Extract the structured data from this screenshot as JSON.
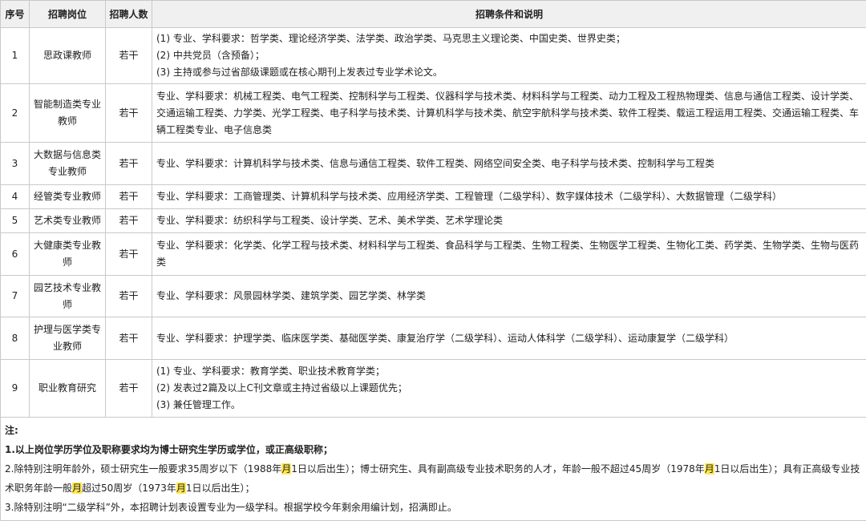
{
  "headers": [
    "序号",
    "招聘岗位",
    "招聘人数",
    "招聘条件和说明"
  ],
  "rows": [
    {
      "no": "1",
      "post": "思政课教师",
      "count": "若干",
      "lines": [
        "(1) 专业、学科要求：哲学类、理论经济学类、法学类、政治学类、马克思主义理论类、中国史类、世界史类；",
        "(2) 中共党员（含预备）；",
        "(3) 主持或参与过省部级课题或在核心期刊上发表过专业学术论文。"
      ]
    },
    {
      "no": "2",
      "post": "智能制造类专业教师",
      "count": "若干",
      "lines": [
        "专业、学科要求：机械工程类、电气工程类、控制科学与工程类、仪器科学与技术类、材料科学与工程类、动力工程及工程热物理类、信息与通信工程类、设计学类、交通运输工程类、力学类、光学工程类、电子科学与技术类、计算机科学与技术类、航空宇航科学与技术类、软件工程类、载运工程运用工程类、交通运输工程类、车辆工程类专业、电子信息类"
      ]
    },
    {
      "no": "3",
      "post": "大数据与信息类专业教师",
      "count": "若干",
      "lines": [
        "专业、学科要求：计算机科学与技术类、信息与通信工程类、软件工程类、网络空间安全类、电子科学与技术类、控制科学与工程类"
      ]
    },
    {
      "no": "4",
      "post": "经管类专业教师",
      "count": "若干",
      "lines": [
        "专业、学科要求：工商管理类、计算机科学与技术类、应用经济学类、工程管理（二级学科）、数字媒体技术（二级学科）、大数据管理（二级学科）"
      ]
    },
    {
      "no": "5",
      "post": "艺术类专业教师",
      "count": "若干",
      "lines": [
        "专业、学科要求：纺织科学与工程类、设计学类、艺术、美术学类、艺术学理论类"
      ]
    },
    {
      "no": "6",
      "post": "大健康类专业教师",
      "count": "若干",
      "lines": [
        "专业、学科要求：化学类、化学工程与技术类、材料科学与工程类、食品科学与工程类、生物工程类、生物医学工程类、生物化工类、药学类、生物学类、生物与医药类"
      ]
    },
    {
      "no": "7",
      "post": "园艺技术专业教师",
      "count": "若干",
      "lines": [
        "专业、学科要求：风景园林学类、建筑学类、园艺学类、林学类"
      ]
    },
    {
      "no": "8",
      "post": "护理与医学类专业教师",
      "count": "若干",
      "lines": [
        "专业、学科要求：护理学类、临床医学类、基础医学类、康复治疗学（二级学科）、运动人体科学（二级学科）、运动康复学（二级学科）"
      ]
    },
    {
      "no": "9",
      "post": "职业教育研究",
      "count": "若干",
      "lines": [
        "(1) 专业、学科要求：教育学类、职业技术教育学类；",
        "(2) 发表过2篇及以上C刊文章或主持过省级以上课题优先；",
        "(3) 兼任管理工作。"
      ]
    }
  ],
  "notes": {
    "title": "注:",
    "n1": "1.以上岗位学历学位及职称要求均为博士研究生学历或学位，或正高级职称；",
    "n2_a": "2.除特别注明年龄外，硕士研究生一般要求35周岁以下（1988年",
    "month": "月",
    "n2_b": "1日以后出生）；博士研究生、具有副高级专业技术职务的人才，年龄一般不超过45周岁（1978年",
    "n2_c": "1日以后出生）；具有正高级专业技术职务年龄一般",
    "n2_d": "超过50周岁（1973年",
    "n2_e": "1日以后出生）；",
    "n3": "3.除特别注明“二级学科”外，本招聘计划表设置专业为一级学科。根据学校今年剩余用编计划，招满即止。"
  }
}
